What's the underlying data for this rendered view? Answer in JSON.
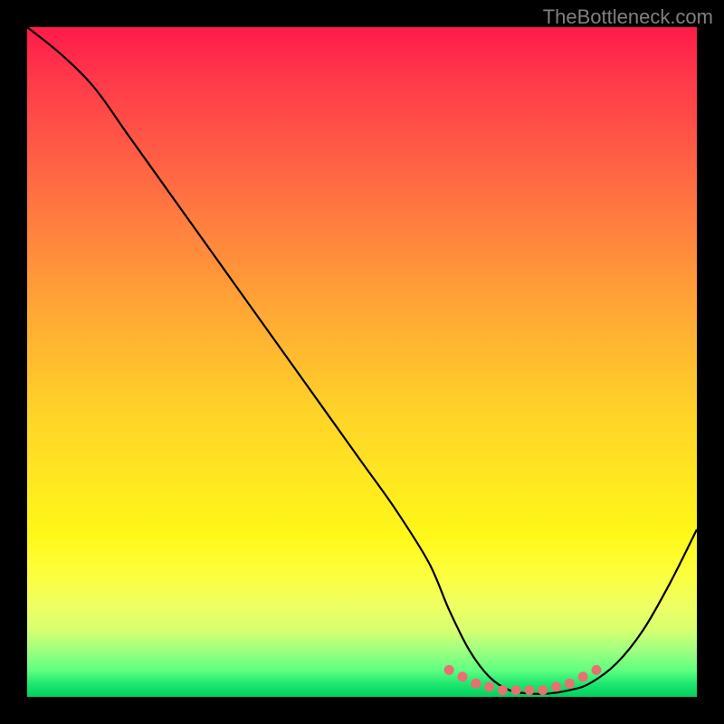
{
  "watermark": "TheBottleneck.com",
  "chart_data": {
    "type": "line",
    "title": "",
    "xlabel": "",
    "ylabel": "",
    "xlim": [
      0,
      100
    ],
    "ylim": [
      0,
      100
    ],
    "series": [
      {
        "name": "bottleneck-curve",
        "x": [
          0,
          5,
          10,
          15,
          20,
          25,
          30,
          35,
          40,
          45,
          50,
          55,
          60,
          63,
          66,
          69,
          72,
          75,
          78,
          81,
          84,
          88,
          92,
          96,
          100
        ],
        "y": [
          100,
          96,
          91,
          84,
          77,
          70,
          63,
          56,
          49,
          42,
          35,
          28,
          20,
          13,
          7,
          3,
          1,
          0.5,
          0.5,
          1,
          2,
          5,
          10,
          17,
          25
        ]
      }
    ],
    "markers": {
      "name": "optimal-range-dots",
      "x": [
        63,
        65,
        67,
        69,
        71,
        73,
        75,
        77,
        79,
        81,
        83,
        85
      ],
      "y": [
        4,
        3,
        2,
        1.5,
        1,
        1,
        1,
        1,
        1.5,
        2,
        3,
        4
      ]
    },
    "gradient_stops": [
      {
        "pos": 0,
        "color": "#ff1a4a"
      },
      {
        "pos": 50,
        "color": "#ffd428"
      },
      {
        "pos": 85,
        "color": "#fcff40"
      },
      {
        "pos": 100,
        "color": "#00d060"
      }
    ]
  }
}
